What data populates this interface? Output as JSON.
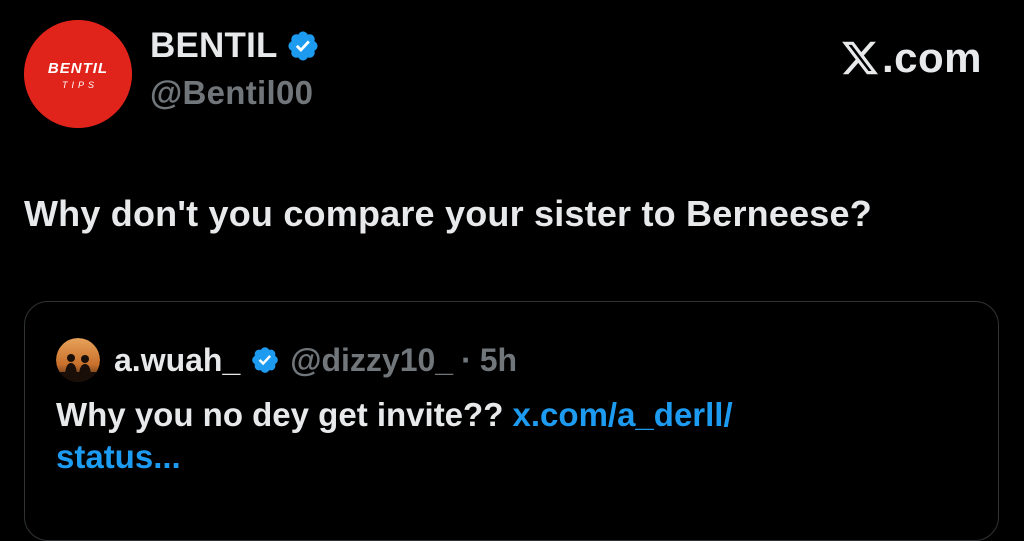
{
  "author": {
    "display_name": "BENTIL",
    "handle": "@Bentil00",
    "avatar_text_top": "BENTIL",
    "avatar_text_bottom": "TIPS",
    "avatar_color": "#e0241b",
    "verified_icon": "verified-badge-icon"
  },
  "brand": {
    "logo_icon": "x-logo-icon",
    "text": ".com"
  },
  "tweet": {
    "text": "Why don't you compare your sister to Berneese?"
  },
  "quoted_tweet": {
    "display_name": "a.wuah_",
    "handle": "@dizzy10_",
    "separator": "·",
    "time": "5h",
    "verified_icon": "verified-badge-icon",
    "avatar_icon": "silhouette-avatar-icon",
    "body_text": "Why you no dey get invite??",
    "link_text_line1": "x.com/a_derll/",
    "link_text_line2": "status..."
  },
  "colors": {
    "background": "#000000",
    "primary_text": "#e7e9ea",
    "secondary_text": "#71767b",
    "link": "#1d9bf0",
    "verified": "#1d9bf0",
    "border": "#2f3336"
  }
}
